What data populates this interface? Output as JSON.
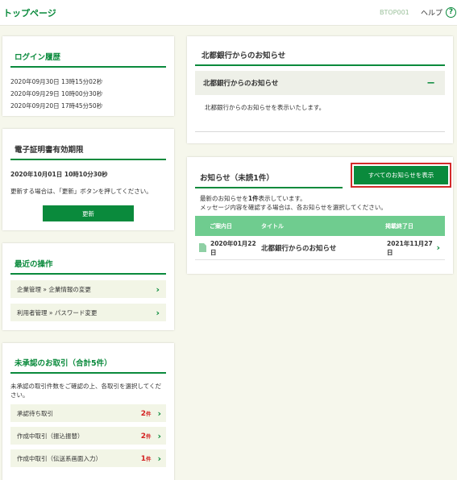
{
  "header": {
    "title": "トップページ",
    "screen_id": "BTOP001",
    "help_label": "ヘルプ",
    "help_icon": "?"
  },
  "login_history": {
    "title": "ログイン履歴",
    "entries": [
      "2020年09月30日 13時15分02秒",
      "2020年09月29日 10時00分30秒",
      "2020年09月20日 17時45分50秒"
    ]
  },
  "certificate": {
    "title": "電子証明書有効期限",
    "expiry": "2020年10月01日 10時10分30秒",
    "note": "更新する場合は、「更新」ボタンを押してください。",
    "update_label": "更新"
  },
  "recent_ops": {
    "title": "最近の操作",
    "items": [
      {
        "label": "企業管理 » 企業情報の変更"
      },
      {
        "label": "利用者管理 » パスワード変更"
      }
    ]
  },
  "pending": {
    "title": "未承認のお取引（合計5件）",
    "note": "未承認の取引件数をご確認の上、各取引を選択してください。",
    "unit": "件",
    "rows": [
      {
        "label": "承認待ち取引",
        "count": "2"
      },
      {
        "label": "作成中取引（振込振替）",
        "count": "2"
      },
      {
        "label": "作成中取引（伝送系画面入力）",
        "count": "1"
      }
    ]
  },
  "bank_notice": {
    "title": "北都銀行からのお知らせ",
    "accordion_title": "北都銀行からのお知らせ",
    "body": "北都銀行からのお知らせを表示いたします。"
  },
  "notices": {
    "title": "お知らせ（未読1件）",
    "show_all_label": "すべてのお知らせを表示",
    "msg_line1_pre": "最新のお知らせを",
    "msg_count": "1件",
    "msg_line1_post": "表示しています。",
    "msg_line2": "メッセージ内容を確認する場合は、各お知らせを選択してください。",
    "columns": [
      "ご案内日",
      "タイトル",
      "掲載終了日"
    ],
    "rows": [
      {
        "date": "2020年01月22日",
        "title": "北都銀行からのお知らせ",
        "end": "2021年11月27日"
      }
    ]
  },
  "colors": {
    "accent": "#0a8a3c",
    "highlight_border": "#d42a2a",
    "count_red": "#d32020",
    "table_head": "#6fcc8f"
  }
}
